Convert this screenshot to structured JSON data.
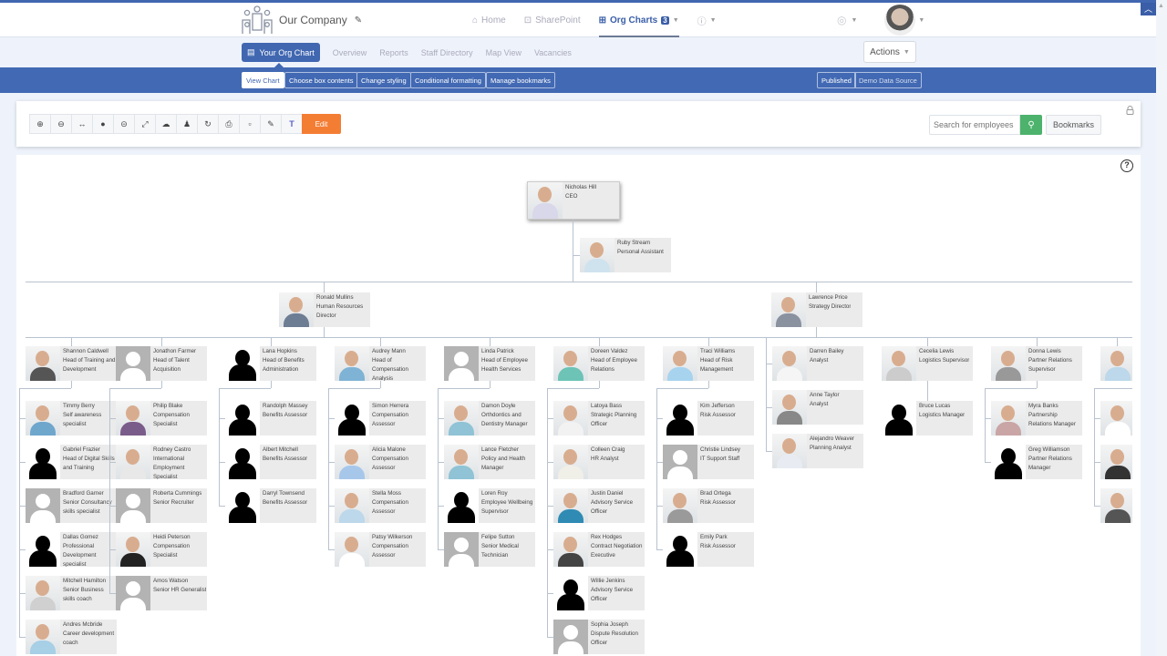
{
  "header": {
    "company_name": "Our Company",
    "nav": [
      {
        "label": "Home",
        "icon": "home-icon"
      },
      {
        "label": "SharePoint",
        "icon": "sharepoint-icon"
      },
      {
        "label": "Org Charts",
        "icon": "grid-icon",
        "badge": "3",
        "active": true
      },
      {
        "label": "",
        "icon": "help-circle-icon"
      }
    ]
  },
  "subnav": {
    "tabs": [
      {
        "label": "Your Org Chart",
        "active": true
      },
      {
        "label": "Overview"
      },
      {
        "label": "Reports"
      },
      {
        "label": "Staff Directory"
      },
      {
        "label": "Map View"
      },
      {
        "label": "Vacancies"
      }
    ],
    "actions_label": "Actions"
  },
  "toolband": {
    "left": [
      "View Chart",
      "Choose box contents",
      "Change styling",
      "Conditional formatting",
      "Manage bookmarks"
    ],
    "right": [
      "Published",
      "Demo Data Source"
    ]
  },
  "toolbar": {
    "icons": [
      "zoom-in-icon",
      "zoom-out-icon",
      "fit-width-icon",
      "expand-all-icon",
      "collapse-all-icon",
      "fullscreen-icon",
      "upload-icon",
      "person-icon",
      "refresh-icon",
      "print-icon",
      "export-icon",
      "brush-icon",
      "teams-icon"
    ],
    "edit_label": "Edit",
    "search_placeholder": "Search for employees",
    "bookmarks_label": "Bookmarks"
  },
  "colors": {
    "brand_blue": "#4167b1",
    "edit_orange": "#f47d34",
    "search_green": "#4cb26c"
  },
  "org": {
    "ceo": {
      "name": "Nicholas Hill",
      "title": "CEO"
    },
    "assistant": {
      "name": "Ruby Stream",
      "title": "Personal Assistant"
    },
    "directors": [
      {
        "name": "Ronald Mullins",
        "title": "Human Resources Director"
      },
      {
        "name": "Lawrence Price",
        "title": "Strategy Director"
      }
    ],
    "columns": [
      {
        "head": {
          "name": "Shannon Caldwell",
          "title": "Head of Training and Development"
        },
        "reports": [
          {
            "name": "Timmy Berry",
            "title": "Self awareness specialist"
          },
          {
            "name": "Gabriel Frazier",
            "title": "Head of Digital Skills and Training"
          },
          {
            "name": "Bradford Garner",
            "title": "Senior Consultancy skills specialist"
          },
          {
            "name": "Dallas Gomez",
            "title": "Professional Development specialist"
          },
          {
            "name": "Mitchell Hamilton",
            "title": "Senior Business skills coach"
          },
          {
            "name": "Andres Mcbride",
            "title": "Career development coach"
          }
        ]
      },
      {
        "head": {
          "name": "Jonathon Farmer",
          "title": "Head of Talent Acquisition"
        },
        "reports": [
          {
            "name": "Philip Blake",
            "title": "Compensation Specialist"
          },
          {
            "name": "Rodney Castro",
            "title": "International Employment Specialist"
          },
          {
            "name": "Roberta Cummings",
            "title": "Senior Recruiter"
          },
          {
            "name": "Heidi Peterson",
            "title": "Compensation Specialist"
          },
          {
            "name": "Amos Watson",
            "title": "Senior HR Generalist"
          }
        ]
      },
      {
        "head": {
          "name": "Lana Hopkins",
          "title": "Head of Benefits Administration"
        },
        "reports": [
          {
            "name": "Randolph Massey",
            "title": "Benefits Assessor"
          },
          {
            "name": "Albert Mitchell",
            "title": "Benefits Assessor"
          },
          {
            "name": "Darryl Townsend",
            "title": "Benefits Assessor"
          }
        ]
      },
      {
        "head": {
          "name": "Audrey Mann",
          "title": "Head of Compensation Analysis"
        },
        "reports": [
          {
            "name": "Simon Herrera",
            "title": "Compensation Assessor"
          },
          {
            "name": "Alicia Malone",
            "title": "Compensation Assessor"
          },
          {
            "name": "Stella Moss",
            "title": "Compensation Assessor"
          },
          {
            "name": "Patsy Wilkerson",
            "title": "Compensation Assessor"
          }
        ]
      },
      {
        "head": {
          "name": "Linda Patrick",
          "title": "Head of Employee Health Services"
        },
        "reports": [
          {
            "name": "Damon Doyle",
            "title": "Orthdontics and Dentistry Manager"
          },
          {
            "name": "Lance Fletcher",
            "title": "Policy and Health Manager"
          },
          {
            "name": "Loren Roy",
            "title": "Employee Wellbeing Supervisor"
          },
          {
            "name": "Felipe Sutton",
            "title": "Senior Medical Technician"
          }
        ]
      },
      {
        "head": {
          "name": "Doreen Valdez",
          "title": "Head of Employee Relations"
        },
        "reports": [
          {
            "name": "Latoya Bass",
            "title": "Strategic Planning Officer"
          },
          {
            "name": "Colleen Craig",
            "title": "HR Analyst"
          },
          {
            "name": "Justin Daniel",
            "title": "Advisory Service Officer"
          },
          {
            "name": "Rex Hodges",
            "title": "Contract Negotiation Executive"
          },
          {
            "name": "Willie Jenkins",
            "title": "Advisory Service Officer"
          },
          {
            "name": "Sophia Joseph",
            "title": "Dispute Resolution Officer"
          }
        ]
      },
      {
        "head": {
          "name": "Traci Williams",
          "title": "Head of Risk Management"
        },
        "reports": [
          {
            "name": "Kim Jefferson",
            "title": "Risk Assessor"
          },
          {
            "name": "Christie Lindsey",
            "title": "IT Support Staff"
          },
          {
            "name": "Brad Ortega",
            "title": "Risk Assessor"
          },
          {
            "name": "Emily Park",
            "title": "Risk Assessor"
          }
        ]
      },
      {
        "head": null,
        "reports": [
          {
            "name": "Darren Bailey",
            "title": "Analyst"
          },
          {
            "name": "Anne Taylor",
            "title": "Analyst"
          },
          {
            "name": "Alejandro Weaver",
            "title": "Planning Analyst"
          }
        ]
      },
      {
        "head": {
          "name": "Cecelia Lewis",
          "title": "Logistics Supervisor"
        },
        "reports": [
          {
            "name": "Bruce Lucas",
            "title": "Logistics Manager"
          }
        ]
      },
      {
        "head": {
          "name": "Donna Lewis",
          "title": "Partner Relations Supervisor"
        },
        "reports": [
          {
            "name": "Myra Banks",
            "title": "Partnership Relations Manager"
          },
          {
            "name": "Greg Williamson",
            "title": "Partner Relations Manager"
          }
        ]
      }
    ]
  }
}
